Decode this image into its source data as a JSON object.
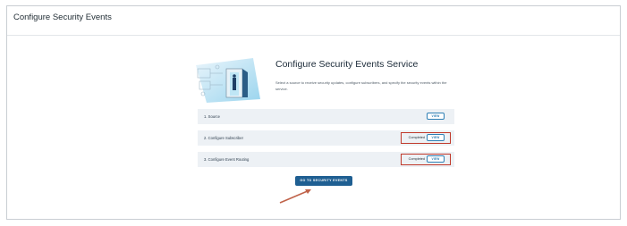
{
  "page": {
    "title": "Configure Security Events"
  },
  "hero": {
    "title": "Configure Security Events Service",
    "description": "Select a source to receive security updates, configure subscribers, and specify the security events within the service."
  },
  "steps": [
    {
      "label": "1.  Source",
      "status": "",
      "button": "VIEW"
    },
    {
      "label": "2.  Configure Subscriber",
      "status": "Completed",
      "button": "VIEW"
    },
    {
      "label": "3.  Configure Event Routing",
      "status": "Completed",
      "button": "VIEW"
    }
  ],
  "primary_action": {
    "label": "GO TO SECURITY EVENTS"
  },
  "colors": {
    "accent": "#2e7fb4",
    "primary_button": "#1f5f92",
    "highlight": "#c0392b",
    "annotation_arrow": "#c0634a",
    "step_bg": "#edf1f5"
  }
}
